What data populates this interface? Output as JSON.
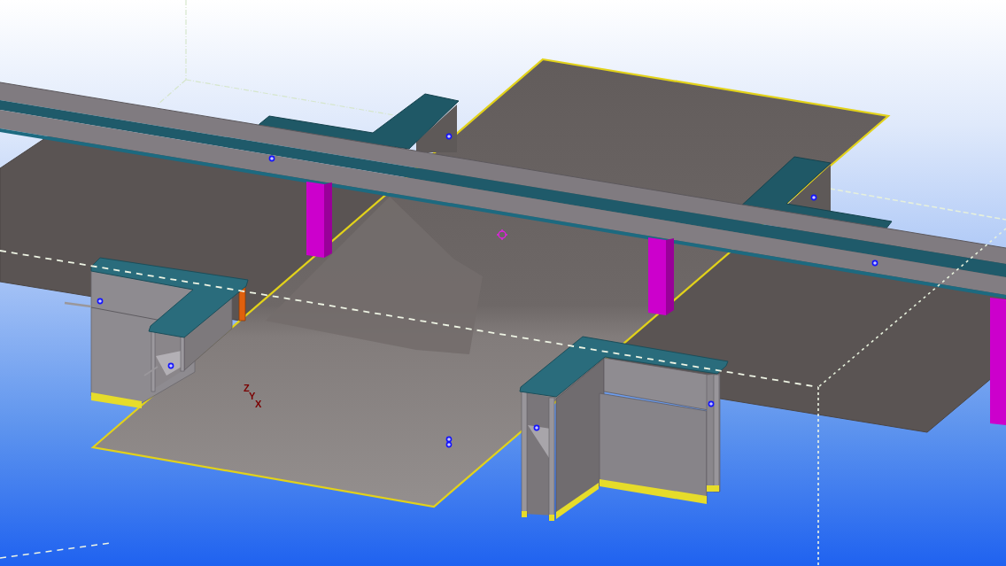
{
  "model_view": {
    "axis_labels": [
      "Z",
      "Y",
      "X"
    ]
  }
}
